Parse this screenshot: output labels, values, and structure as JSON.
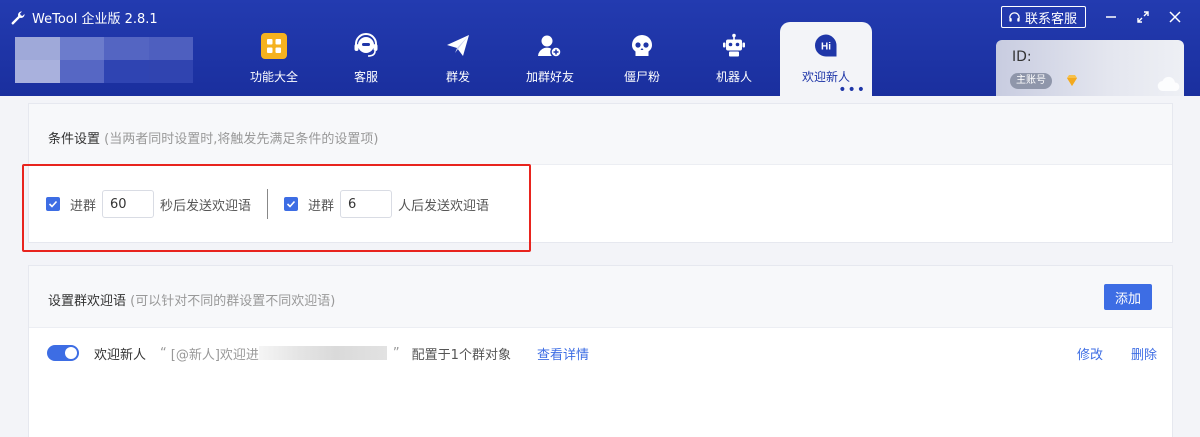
{
  "app": {
    "title": "WeTool 企业版 2.8.1"
  },
  "window": {
    "service_label": "联系客服"
  },
  "nav": {
    "items": [
      {
        "label": "功能大全",
        "icon": "grid-icon"
      },
      {
        "label": "客服",
        "icon": "headset-icon"
      },
      {
        "label": "群发",
        "icon": "paper-plane-icon"
      },
      {
        "label": "加群好友",
        "icon": "add-user-icon"
      },
      {
        "label": "僵尸粉",
        "icon": "skull-icon"
      },
      {
        "label": "机器人",
        "icon": "robot-icon"
      },
      {
        "label": "欢迎新人",
        "icon": "hi-bubble-icon",
        "icon_text": "Hi",
        "active": true
      }
    ],
    "more": "•••"
  },
  "account": {
    "id_label": "ID:",
    "badge": "主账号"
  },
  "conditions": {
    "title": "条件设置",
    "hint": "(当两者同时设置时,将触发先满足条件的设置项)",
    "time_prefix": "进群",
    "time_value": "60",
    "time_suffix": "秒后发送欢迎语",
    "count_prefix": "进群",
    "count_value": "6",
    "count_suffix": "人后发送欢迎语"
  },
  "welcome": {
    "title": "设置群欢迎语",
    "hint": "(可以针对不同的群设置不同欢迎语)",
    "add_label": "添加",
    "rules": [
      {
        "name": "欢迎新人",
        "quote_open": "“",
        "preview": "[@新人]欢迎进",
        "quote_close": "”",
        "config": "配置于1个群对象",
        "detail_label": "查看详情",
        "edit_label": "修改",
        "delete_label": "删除"
      }
    ]
  },
  "colors": {
    "header": "#1f36a8",
    "accent": "#3d6de4",
    "highlight": "#e8241e"
  }
}
